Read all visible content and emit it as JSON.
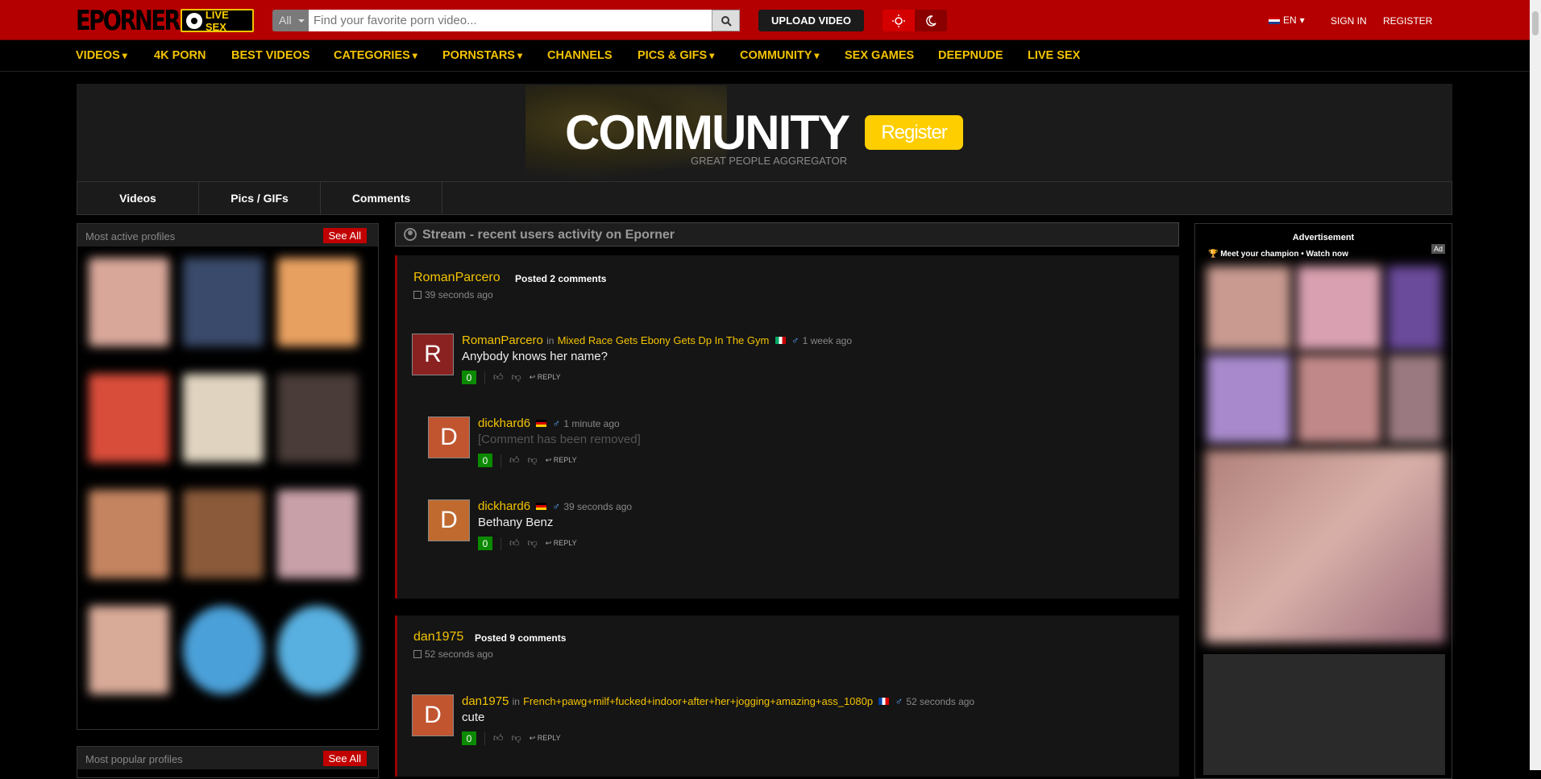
{
  "header": {
    "logo": "EPORNER",
    "livesex_label": "LIVE SEX",
    "search_category": "All",
    "search_placeholder": "Find your favorite porn video...",
    "upload_label": "UPLOAD VIDEO",
    "lang": "EN",
    "signin": "SIGN IN",
    "register": "REGISTER"
  },
  "nav": [
    {
      "label": "VIDEOS",
      "dropdown": true
    },
    {
      "label": "4K PORN",
      "dropdown": false
    },
    {
      "label": "BEST VIDEOS",
      "dropdown": false
    },
    {
      "label": "CATEGORIES",
      "dropdown": true
    },
    {
      "label": "PORNSTARS",
      "dropdown": true
    },
    {
      "label": "CHANNELS",
      "dropdown": false
    },
    {
      "label": "PICS & GIFS",
      "dropdown": true
    },
    {
      "label": "COMMUNITY",
      "dropdown": true
    },
    {
      "label": "SEX GAMES",
      "dropdown": false
    },
    {
      "label": "DEEPNUDE",
      "dropdown": false
    },
    {
      "label": "LIVE SEX",
      "dropdown": false
    }
  ],
  "hero": {
    "title": "COMMUNITY",
    "subtitle": "GREAT PEOPLE AGGREGATOR",
    "register": "Register"
  },
  "tabs": [
    "Videos",
    "Pics / GIFs",
    "Comments"
  ],
  "sidebar": {
    "active_title": "Most active profiles",
    "popular_title": "Most popular profiles",
    "see_all": "See All"
  },
  "stream": {
    "title": "Stream - recent users activity on Eporner",
    "entries": [
      {
        "user": "RomanParcero",
        "action": "Posted 2 comments",
        "time": "39 seconds ago",
        "comments": [
          {
            "initial": "R",
            "user": "RomanParcero",
            "in": "in",
            "video": "Mixed Race Gets Ebony Gets Dp In The Gym",
            "ago": "1 week ago",
            "text": "Anybody knows her name?",
            "score": "0",
            "reply": "REPLY"
          },
          {
            "initial": "D",
            "user": "dickhard6",
            "ago": "1 minute ago",
            "text": "[Comment has been removed]",
            "score": "0",
            "reply": "REPLY"
          },
          {
            "initial": "D",
            "user": "dickhard6",
            "ago": "39 seconds ago",
            "text": "Bethany Benz",
            "score": "0",
            "reply": "REPLY"
          }
        ]
      },
      {
        "user": "dan1975",
        "action": "Posted 9 comments",
        "time": "52 seconds ago",
        "comments": [
          {
            "initial": "D",
            "user": "dan1975",
            "in": "in",
            "video": "French+pawg+milf+fucked+indoor+after+her+jogging+amazing+ass_1080p",
            "ago": "52 seconds ago",
            "text": "cute",
            "score": "0",
            "reply": "REPLY"
          }
        ]
      }
    ]
  },
  "ad": {
    "title": "Advertisement",
    "tag": "Ad",
    "subtitle": "🏆 Meet your champion • Watch now"
  },
  "colors": {
    "accent": "#f3c300",
    "brand": "#b40000",
    "score": "#0b8a00"
  }
}
